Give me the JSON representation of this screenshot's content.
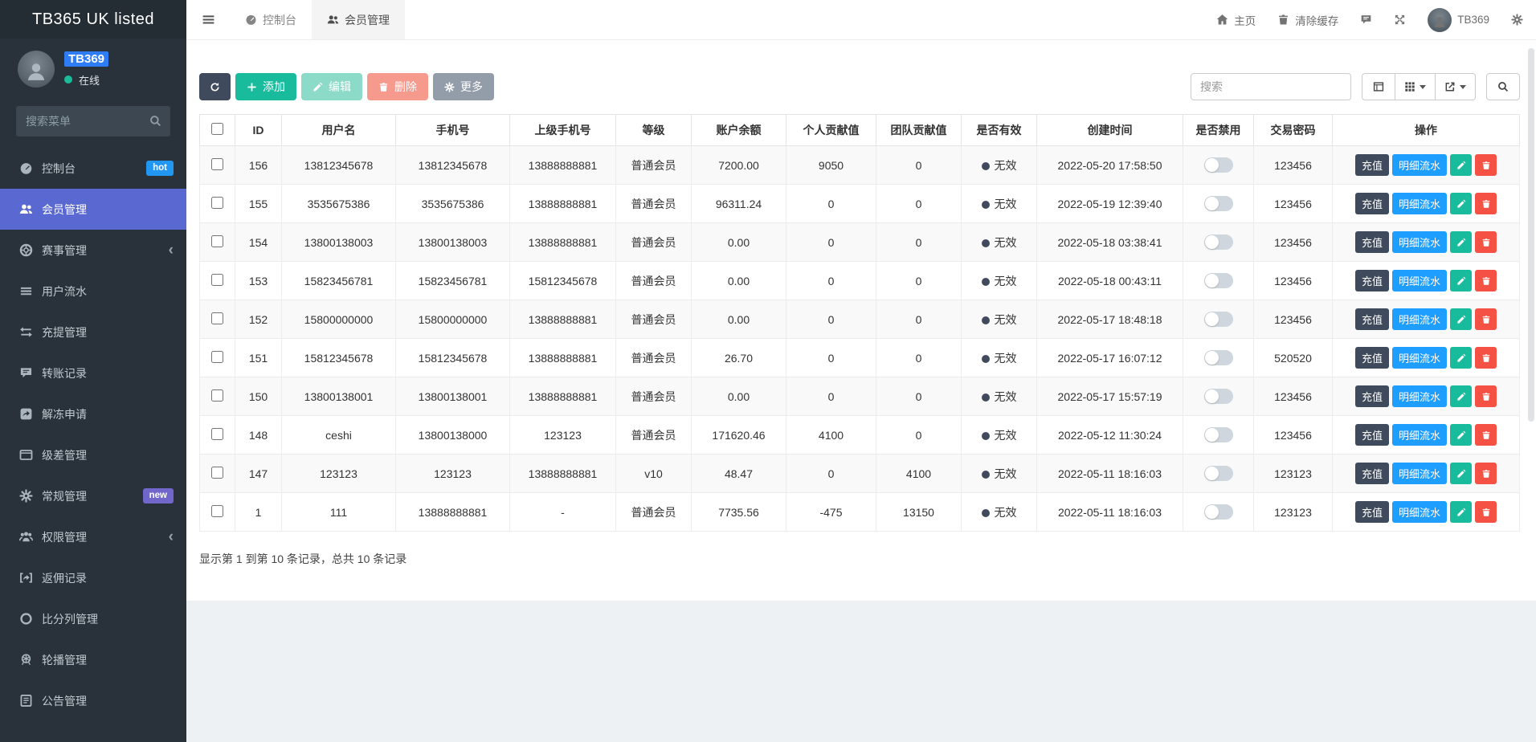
{
  "app": {
    "title": "TB365 UK listed"
  },
  "colors": {
    "sidebar_bg": "#29323a",
    "sidebar_active": "#5a69d2",
    "badge_hot": "#2196f3",
    "badge_new": "#7166c9",
    "online_dot": "#1abc9c",
    "btn_add_green": "#18bc9c",
    "btn_detail_blue": "#1e9fff",
    "btn_delete_red": "#f55145",
    "btn_dark_slate": "#3f4a5c"
  },
  "sidebar": {
    "profile": {
      "name": "TB369",
      "status": "在线",
      "avatar_icon": "person-icon"
    },
    "search_placeholder": "搜索菜单",
    "items": [
      {
        "label": "控制台",
        "icon": "dashboard-icon",
        "badge": "hot"
      },
      {
        "label": "会员管理",
        "icon": "members-icon",
        "active": true
      },
      {
        "label": "赛事管理",
        "icon": "match-icon",
        "arrow": "‹"
      },
      {
        "label": "用户流水",
        "icon": "user-flow-icon"
      },
      {
        "label": "充提管理",
        "icon": "deposit-withdraw-icon"
      },
      {
        "label": "转账记录",
        "icon": "transfer-icon"
      },
      {
        "label": "解冻申请",
        "icon": "unfreeze-icon"
      },
      {
        "label": "级差管理",
        "icon": "level-diff-icon"
      },
      {
        "label": "常规管理",
        "icon": "general-settings-icon",
        "badge": "new"
      },
      {
        "label": "权限管理",
        "icon": "permissions-icon",
        "arrow": "‹"
      },
      {
        "label": "返佣记录",
        "icon": "commission-icon"
      },
      {
        "label": "比分列管理",
        "icon": "score-column-icon"
      },
      {
        "label": "轮播管理",
        "icon": "carousel-icon"
      },
      {
        "label": "公告管理",
        "icon": "announcement-icon"
      }
    ]
  },
  "navbar": {
    "tabs": [
      {
        "label": "控制台",
        "icon": "dashboard-icon"
      },
      {
        "label": "会员管理",
        "icon": "members-icon",
        "active": true
      }
    ],
    "right": {
      "home": "主页",
      "clear_cache": "清除缓存",
      "username": "TB369"
    }
  },
  "toolbar": {
    "add_label": "添加",
    "edit_label": "编辑",
    "delete_label": "删除",
    "more_label": "更多",
    "search_placeholder": "搜索"
  },
  "table": {
    "headers": [
      "ID",
      "用户名",
      "手机号",
      "上级手机号",
      "等级",
      "账户余额",
      "个人贡献值",
      "团队贡献值",
      "是否有效",
      "创建时间",
      "是否禁用",
      "交易密码",
      "操作"
    ],
    "actions": {
      "recharge": "充值",
      "detail": "明细流水"
    },
    "rows": [
      {
        "id": "156",
        "username": "13812345678",
        "phone": "13812345678",
        "parent_phone": "13888888881",
        "level": "普通会员",
        "balance": "7200.00",
        "personal": "9050",
        "team": "0",
        "valid": "无效",
        "created": "2022-05-20 17:58:50",
        "password": "123456"
      },
      {
        "id": "155",
        "username": "3535675386",
        "phone": "3535675386",
        "parent_phone": "13888888881",
        "level": "普通会员",
        "balance": "96311.24",
        "personal": "0",
        "team": "0",
        "valid": "无效",
        "created": "2022-05-19 12:39:40",
        "password": "123456"
      },
      {
        "id": "154",
        "username": "13800138003",
        "phone": "13800138003",
        "parent_phone": "13888888881",
        "level": "普通会员",
        "balance": "0.00",
        "personal": "0",
        "team": "0",
        "valid": "无效",
        "created": "2022-05-18 03:38:41",
        "password": "123456"
      },
      {
        "id": "153",
        "username": "15823456781",
        "phone": "15823456781",
        "parent_phone": "15812345678",
        "level": "普通会员",
        "balance": "0.00",
        "personal": "0",
        "team": "0",
        "valid": "无效",
        "created": "2022-05-18 00:43:11",
        "password": "123456"
      },
      {
        "id": "152",
        "username": "15800000000",
        "phone": "15800000000",
        "parent_phone": "13888888881",
        "level": "普通会员",
        "balance": "0.00",
        "personal": "0",
        "team": "0",
        "valid": "无效",
        "created": "2022-05-17 18:48:18",
        "password": "123456"
      },
      {
        "id": "151",
        "username": "15812345678",
        "phone": "15812345678",
        "parent_phone": "13888888881",
        "level": "普通会员",
        "balance": "26.70",
        "personal": "0",
        "team": "0",
        "valid": "无效",
        "created": "2022-05-17 16:07:12",
        "password": "520520"
      },
      {
        "id": "150",
        "username": "13800138001",
        "phone": "13800138001",
        "parent_phone": "13888888881",
        "level": "普通会员",
        "balance": "0.00",
        "personal": "0",
        "team": "0",
        "valid": "无效",
        "created": "2022-05-17 15:57:19",
        "password": "123456"
      },
      {
        "id": "148",
        "username": "ceshi",
        "phone": "13800138000",
        "parent_phone": "123123",
        "level": "普通会员",
        "balance": "171620.46",
        "personal": "4100",
        "team": "0",
        "valid": "无效",
        "created": "2022-05-12 11:30:24",
        "password": "123456"
      },
      {
        "id": "147",
        "username": "123123",
        "phone": "123123",
        "parent_phone": "13888888881",
        "level": "v10",
        "balance": "48.47",
        "personal": "0",
        "team": "4100",
        "valid": "无效",
        "created": "2022-05-11 18:16:03",
        "password": "123123"
      },
      {
        "id": "1",
        "username": "111",
        "phone": "13888888881",
        "parent_phone": "-",
        "level": "普通会员",
        "balance": "7735.56",
        "personal": "-475",
        "team": "13150",
        "valid": "无效",
        "created": "2022-05-11 18:16:03",
        "password": "123123"
      }
    ],
    "summary": "显示第 1 到第 10 条记录，总共 10 条记录"
  }
}
